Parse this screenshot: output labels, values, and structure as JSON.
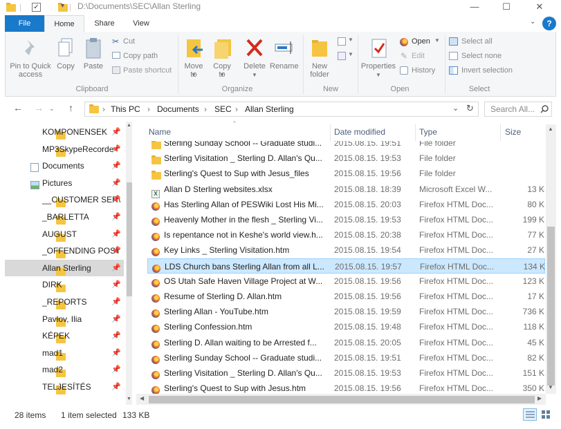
{
  "titlebar": {
    "path": "D:\\Documents\\SEC\\Allan Sterling",
    "minimize": "—",
    "maximize": "☐",
    "close": "✕",
    "qa_dropdown": "▾"
  },
  "tabs": [
    "File",
    "Home",
    "Share",
    "View"
  ],
  "help": "?",
  "ribbon": {
    "clipboard": {
      "pin_label": "Pin to Quick access",
      "copy_label": "Copy",
      "paste_label": "Paste",
      "cut_label": "Cut",
      "copy_path_label": "Copy path",
      "paste_shortcut_label": "Paste shortcut",
      "group_label": "Clipboard"
    },
    "organize": {
      "move_to_label": "Move to",
      "copy_to_label": "Copy to",
      "delete_label": "Delete",
      "rename_label": "Rename",
      "group_label": "Organize"
    },
    "new": {
      "new_folder_label": "New folder",
      "group_label": "New"
    },
    "open": {
      "properties_label": "Properties",
      "open_label": "Open",
      "edit_label": "Edit",
      "history_label": "History",
      "group_label": "Open"
    },
    "select": {
      "select_all_label": "Select all",
      "select_none_label": "Select none",
      "invert_label": "Invert selection",
      "group_label": "Select"
    }
  },
  "address": {
    "crumbs": [
      "This PC",
      "Documents",
      "SEC",
      "Allan Sterling"
    ],
    "separator": "›",
    "search_placeholder": "Search All..."
  },
  "sidebar": {
    "items": [
      {
        "label": "KOMPONENSEK",
        "icon": "folder-icon"
      },
      {
        "label": "MP3SkypeRecorde",
        "icon": "folder-icon"
      },
      {
        "label": "Documents",
        "icon": "documents-icon"
      },
      {
        "label": "Pictures",
        "icon": "pictures-icon"
      },
      {
        "label": "__CUSTOMER SER\\",
        "icon": "folder-icon"
      },
      {
        "label": "_BARLETTA",
        "icon": "folder-icon"
      },
      {
        "label": "AUGUST",
        "icon": "folder-icon"
      },
      {
        "label": "_OFFENDING POST",
        "icon": "folder-icon"
      },
      {
        "label": "Allan Sterling",
        "icon": "folder-icon",
        "selected": true
      },
      {
        "label": "DIRK",
        "icon": "folder-icon"
      },
      {
        "label": "_REPORTS",
        "icon": "folder-icon"
      },
      {
        "label": "Pavlov, Ilia",
        "icon": "folder-icon"
      },
      {
        "label": "KÉPEK",
        "icon": "folder-icon"
      },
      {
        "label": "mad1",
        "icon": "folder-icon"
      },
      {
        "label": "mad2",
        "icon": "folder-icon"
      },
      {
        "label": "TELJESÍTÉS",
        "icon": "folder-icon"
      }
    ]
  },
  "columns": {
    "name": "Name",
    "date": "Date modified",
    "type": "Type",
    "size": "Size"
  },
  "files": [
    {
      "name": "Sterling Sunday School -- Graduate studi...",
      "date": "2015.08.15. 19:51",
      "type": "File folder",
      "size": "",
      "icon": "folder-icon"
    },
    {
      "name": "Sterling Visitation _ Sterling D. Allan's Qu...",
      "date": "2015.08.15. 19:53",
      "type": "File folder",
      "size": "",
      "icon": "folder-icon"
    },
    {
      "name": "Sterling's Quest to Sup with Jesus_files",
      "date": "2015.08.15. 19:56",
      "type": "File folder",
      "size": "",
      "icon": "folder-icon"
    },
    {
      "name": "Allan D Sterling websites.xlsx",
      "date": "2015.08.18. 18:39",
      "type": "Microsoft Excel W...",
      "size": "13 K",
      "icon": "excel-icon"
    },
    {
      "name": "Has Sterling Allan of PESWiki Lost His Mi...",
      "date": "2015.08.15. 20:03",
      "type": "Firefox HTML Doc...",
      "size": "80 K",
      "icon": "firefox-icon"
    },
    {
      "name": "Heavenly Mother in the flesh _ Sterling Vi...",
      "date": "2015.08.15. 19:53",
      "type": "Firefox HTML Doc...",
      "size": "199 K",
      "icon": "firefox-icon"
    },
    {
      "name": "Is repentance not in Keshe's world view.h...",
      "date": "2015.08.15. 20:38",
      "type": "Firefox HTML Doc...",
      "size": "77 K",
      "icon": "firefox-icon"
    },
    {
      "name": "Key Links _ Sterling Visitation.htm",
      "date": "2015.08.15. 19:54",
      "type": "Firefox HTML Doc...",
      "size": "27 K",
      "icon": "firefox-icon"
    },
    {
      "name": "LDS Church bans Sterling Allan from all L...",
      "date": "2015.08.15. 19:57",
      "type": "Firefox HTML Doc...",
      "size": "134 K",
      "icon": "firefox-icon",
      "selected": true
    },
    {
      "name": "OS Utah Safe Haven Village Project at W...",
      "date": "2015.08.15. 19:56",
      "type": "Firefox HTML Doc...",
      "size": "123 K",
      "icon": "firefox-icon"
    },
    {
      "name": "Resume of Sterling D. Allan.htm",
      "date": "2015.08.15. 19:56",
      "type": "Firefox HTML Doc...",
      "size": "17 K",
      "icon": "firefox-icon"
    },
    {
      "name": "Sterling Allan - YouTube.htm",
      "date": "2015.08.15. 19:59",
      "type": "Firefox HTML Doc...",
      "size": "736 K",
      "icon": "firefox-icon"
    },
    {
      "name": "Sterling Confession.htm",
      "date": "2015.08.15. 19:48",
      "type": "Firefox HTML Doc...",
      "size": "118 K",
      "icon": "firefox-icon"
    },
    {
      "name": "Sterling D. Allan waiting to be Arrested f...",
      "date": "2015.08.15. 20:05",
      "type": "Firefox HTML Doc...",
      "size": "45 K",
      "icon": "firefox-icon"
    },
    {
      "name": "Sterling Sunday School -- Graduate studi...",
      "date": "2015.08.15. 19:51",
      "type": "Firefox HTML Doc...",
      "size": "82 K",
      "icon": "firefox-icon"
    },
    {
      "name": "Sterling Visitation _ Sterling D. Allan's Qu...",
      "date": "2015.08.15. 19:53",
      "type": "Firefox HTML Doc...",
      "size": "151 K",
      "icon": "firefox-icon"
    },
    {
      "name": "Sterling's Quest to Sup with Jesus.htm",
      "date": "2015.08.15. 19:56",
      "type": "Firefox HTML Doc...",
      "size": "350 K",
      "icon": "firefox-icon"
    }
  ],
  "status": {
    "item_count": "28 items",
    "selection": "1 item selected",
    "size": "133 KB"
  },
  "colors": {
    "accent": "#1979ca",
    "selection": "#cce8ff",
    "folder": "#f5c542",
    "delete_red": "#d42b1e"
  }
}
